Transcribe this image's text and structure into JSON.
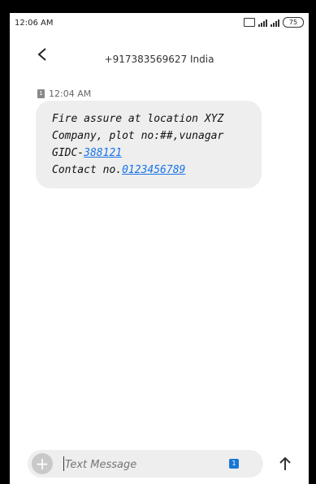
{
  "status_bar": {
    "time": "12:06 AM",
    "battery": "75"
  },
  "header": {
    "contact": "+917383569627 India"
  },
  "message": {
    "sim_label": "1",
    "time": "12:04 AM",
    "line1": "Fire assure at location XYZ",
    "line2": "Company, plot no:##,vunagar",
    "line3_prefix": "GIDC-",
    "line3_link": "388121",
    "line4_prefix": "Contact no.",
    "line4_link": "0123456789"
  },
  "composer": {
    "placeholder": "Text Message",
    "sim_label": "1"
  },
  "colors": {
    "link": "#1a73e8",
    "bubble": "#eeeeee",
    "accent": "#1976d2"
  }
}
